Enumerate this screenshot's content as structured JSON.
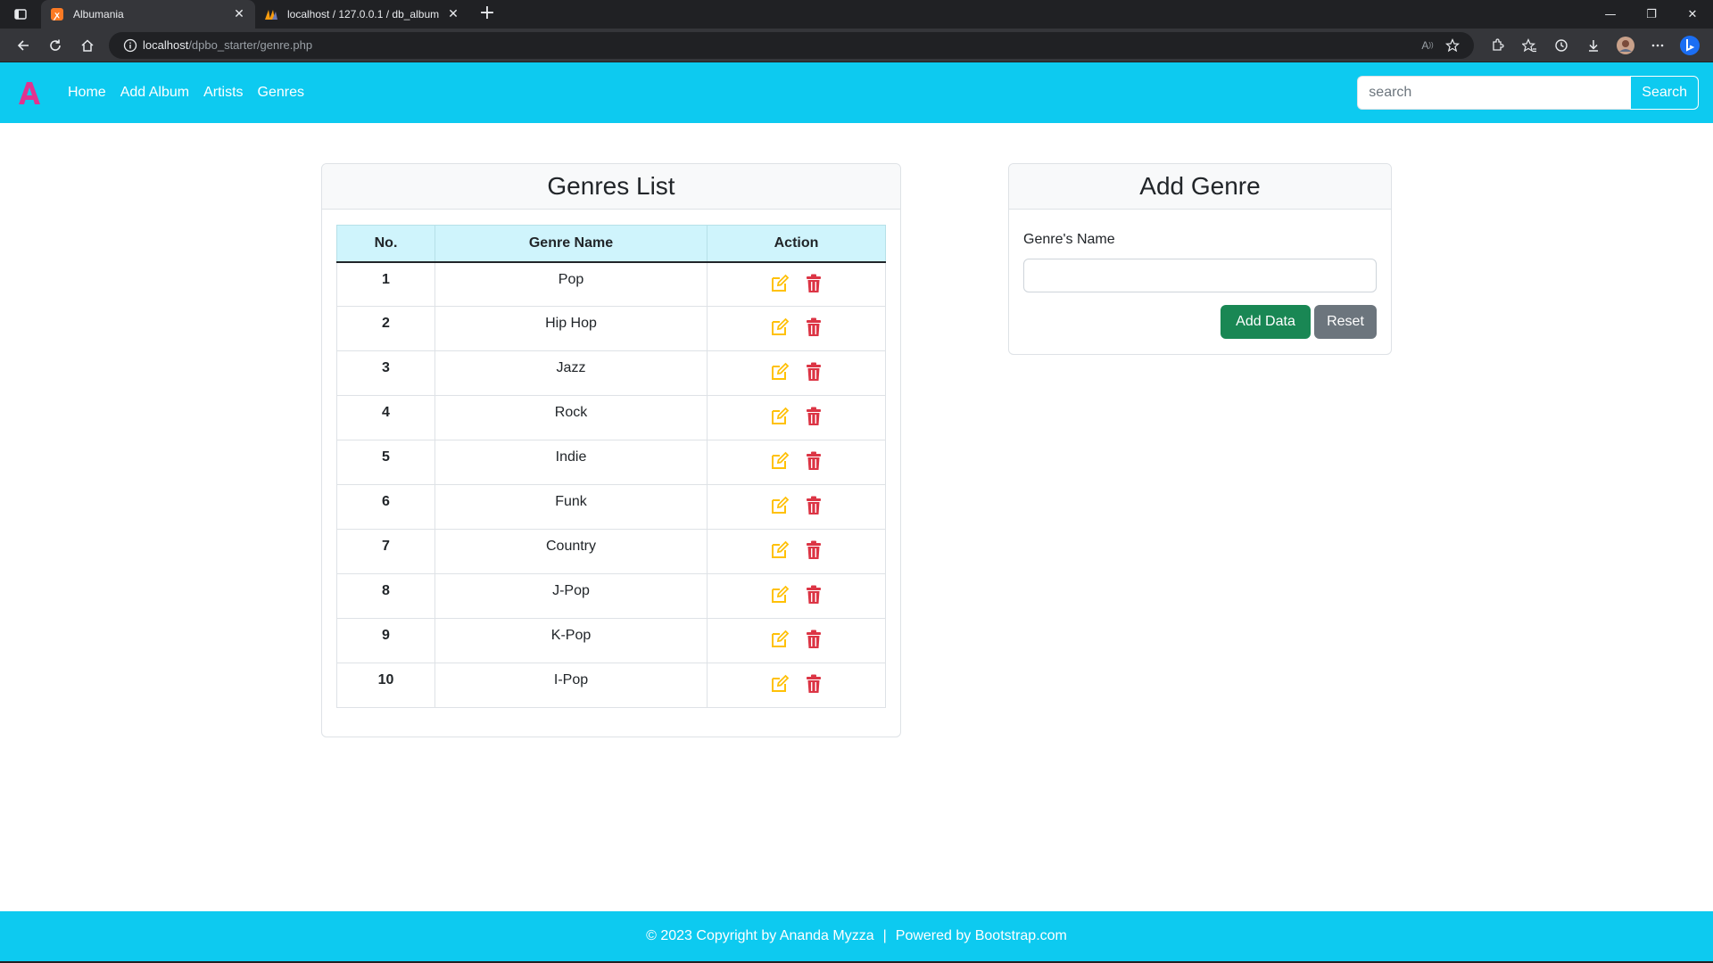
{
  "browser": {
    "tabs": [
      {
        "title": "Albumania",
        "active": true,
        "favicon": "xampp-icon"
      },
      {
        "title": "localhost / 127.0.0.1 / db_album",
        "active": false,
        "favicon": "phpmyadmin-icon"
      }
    ],
    "url_host": "localhost",
    "url_path": "/dpbo_starter/genre.php"
  },
  "navbar": {
    "brand": "A",
    "links": [
      "Home",
      "Add Album",
      "Artists",
      "Genres"
    ],
    "search_placeholder": "search",
    "search_button": "Search"
  },
  "genres": {
    "title": "Genres List",
    "columns": [
      "No.",
      "Genre Name",
      "Action"
    ],
    "rows": [
      {
        "no": "1",
        "name": "Pop"
      },
      {
        "no": "2",
        "name": "Hip Hop"
      },
      {
        "no": "3",
        "name": "Jazz"
      },
      {
        "no": "4",
        "name": "Rock"
      },
      {
        "no": "5",
        "name": "Indie"
      },
      {
        "no": "6",
        "name": "Funk"
      },
      {
        "no": "7",
        "name": "Country"
      },
      {
        "no": "8",
        "name": "J-Pop"
      },
      {
        "no": "9",
        "name": "K-Pop"
      },
      {
        "no": "10",
        "name": "I-Pop"
      }
    ]
  },
  "add_genre": {
    "title": "Add Genre",
    "label": "Genre's Name",
    "value": "",
    "add_button": "Add Data",
    "reset_button": "Reset"
  },
  "footer": {
    "copyright": "© 2023 Copyright by Ananda Myzza",
    "separator": "|",
    "powered": "Powered by Bootstrap.com"
  },
  "colors": {
    "primary": "#0dcaf0",
    "brand": "#e0338f",
    "edit": "#ffc107",
    "delete": "#dc3545",
    "success": "#198754",
    "secondary": "#6c757d",
    "table_head": "#cff4fc"
  }
}
